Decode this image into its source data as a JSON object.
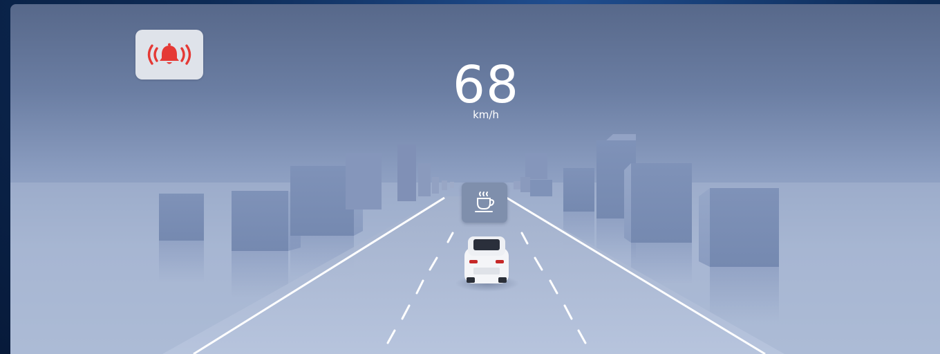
{
  "app": {
    "alert_icon": "bell-alert-icon",
    "rest_icon": "coffee-cup-icon"
  },
  "speed": {
    "value": "68",
    "unit": "km/h"
  },
  "colors": {
    "alert_red": "#e53935",
    "badge_background": "#dfe3ea",
    "speed_text": "#ffffff"
  }
}
